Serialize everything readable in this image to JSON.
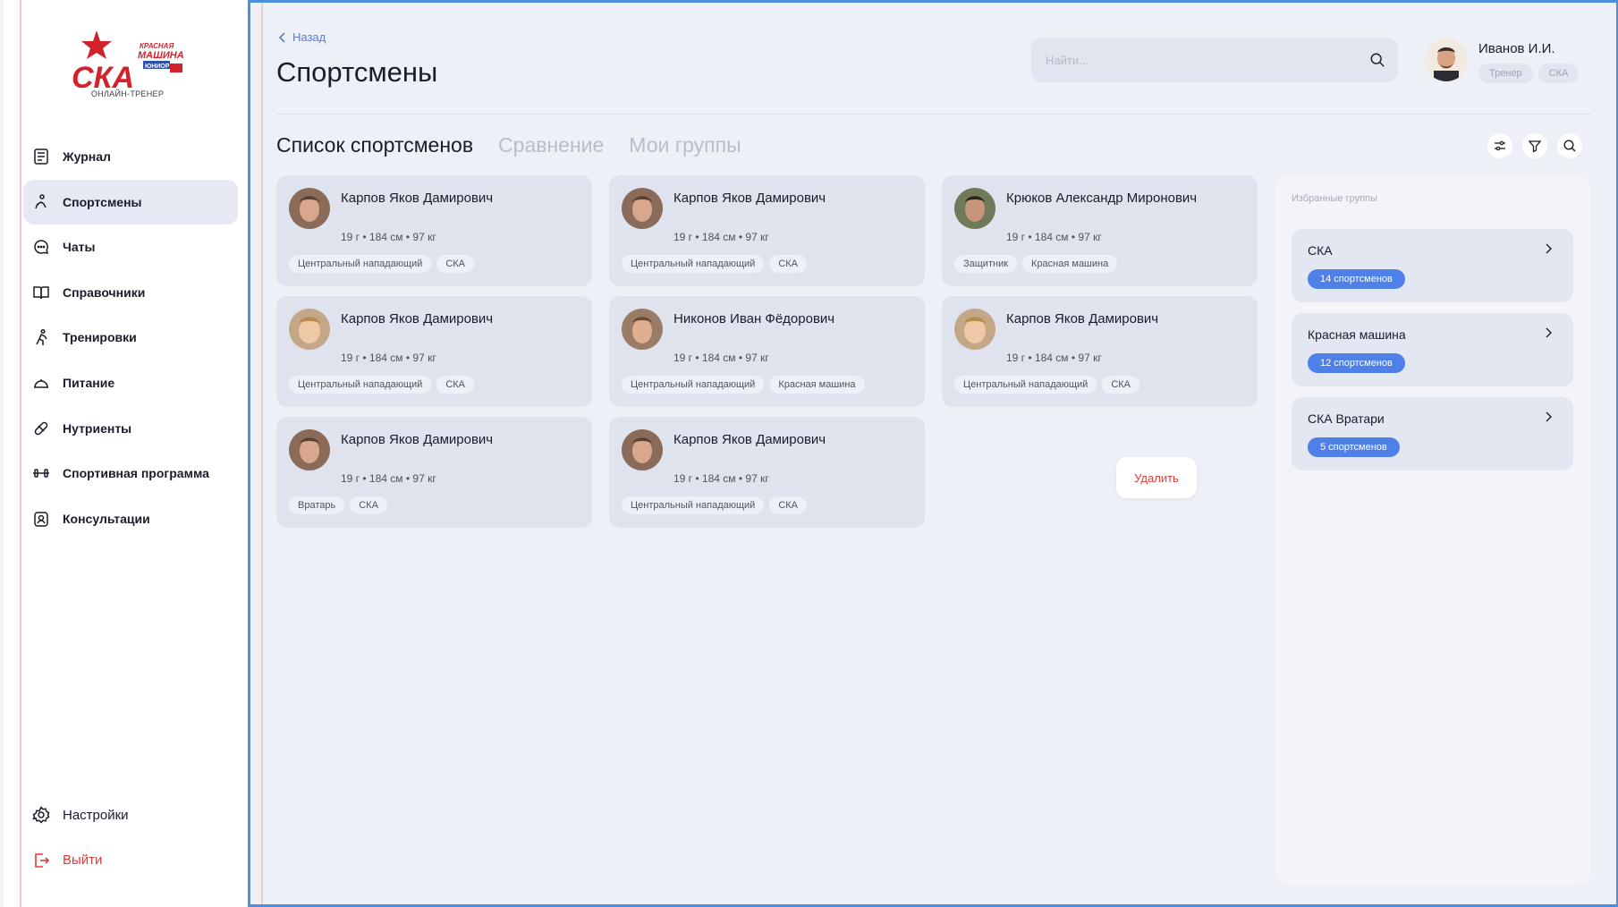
{
  "sidebar": {
    "logo_alt": "СКА / Красная машина Юниор",
    "logo_subtitle": "ОНЛАЙН-ТРЕНЕР",
    "items": [
      {
        "label": "Журнал",
        "icon": "journal-icon"
      },
      {
        "label": "Спортсмены",
        "icon": "athlete-icon",
        "active": true
      },
      {
        "label": "Чаты",
        "icon": "chat-icon"
      },
      {
        "label": "Справочники",
        "icon": "book-icon"
      },
      {
        "label": "Тренировки",
        "icon": "training-icon"
      },
      {
        "label": "Питание",
        "icon": "food-icon"
      },
      {
        "label": "Нутриенты",
        "icon": "pill-icon"
      },
      {
        "label": "Спортивная программа",
        "icon": "dumbbell-icon"
      },
      {
        "label": "Консультации",
        "icon": "consultation-icon"
      }
    ],
    "settings_label": "Настройки",
    "logout_label": "Выйти"
  },
  "header": {
    "back_label": "Назад",
    "title": "Спортсмены",
    "search_placeholder": "Найти...",
    "user": {
      "name": "Иванов И.И.",
      "tags": [
        "Тренер",
        "СКА"
      ]
    }
  },
  "tabs": [
    {
      "label": "Список спортсменов",
      "active": true
    },
    {
      "label": "Сравнение"
    },
    {
      "label": "Мои группы"
    }
  ],
  "athletes": [
    {
      "name": "Карпов Яков Дамирович",
      "meta": "19 г  •  184 см  •  97 кг",
      "tags": [
        "Центральный нападающий",
        "СКА"
      ]
    },
    {
      "name": "Карпов Яков Дамирович",
      "meta": "19 г  •  184 см  •  97 кг",
      "tags": [
        "Центральный нападающий",
        "СКА"
      ]
    },
    {
      "name": "Крюков Александр Миронович",
      "meta": "19 г  •  184 см  •  97 кг",
      "tags": [
        "Защитник",
        "Красная машина"
      ]
    },
    {
      "name": "Карпов Яков Дамирович",
      "meta": "19 г  •  184 см  •  97 кг",
      "tags": [
        "Центральный нападающий",
        "СКА"
      ]
    },
    {
      "name": "Никонов Иван Фёдорович",
      "meta": "19 г  •  184 см  •  97 кг",
      "tags": [
        "Центральный нападающий",
        "Красная машина"
      ]
    },
    {
      "name": "Карпов Яков Дамирович",
      "meta": "19 г  •  184 см  •  97 кг",
      "tags": [
        "Центральный нападающий",
        "СКА"
      ]
    },
    {
      "name": "Карпов Яков Дамирович",
      "meta": "19 г  •  184 см  •  97 кг",
      "tags": [
        "Вратарь",
        "СКА"
      ]
    },
    {
      "name": "Карпов Яков Дамирович",
      "meta": "19 г  •  184 см  •  97 кг",
      "tags": [
        "Центральный нападающий",
        "СКА"
      ]
    }
  ],
  "delete_label": "Удалить",
  "favorites": {
    "title": "Избранные группы",
    "groups": [
      {
        "name": "СКА",
        "count": "14 спортсменов"
      },
      {
        "name": "Красная машина",
        "count": "12 спортсменов"
      },
      {
        "name": "СКА Вратари",
        "count": "5 спортсменов"
      }
    ]
  },
  "colors": {
    "accent": "#4f80e8",
    "danger": "#e23a3a",
    "card_bg": "#dfe3ee",
    "main_bg": "#eef0f7"
  }
}
